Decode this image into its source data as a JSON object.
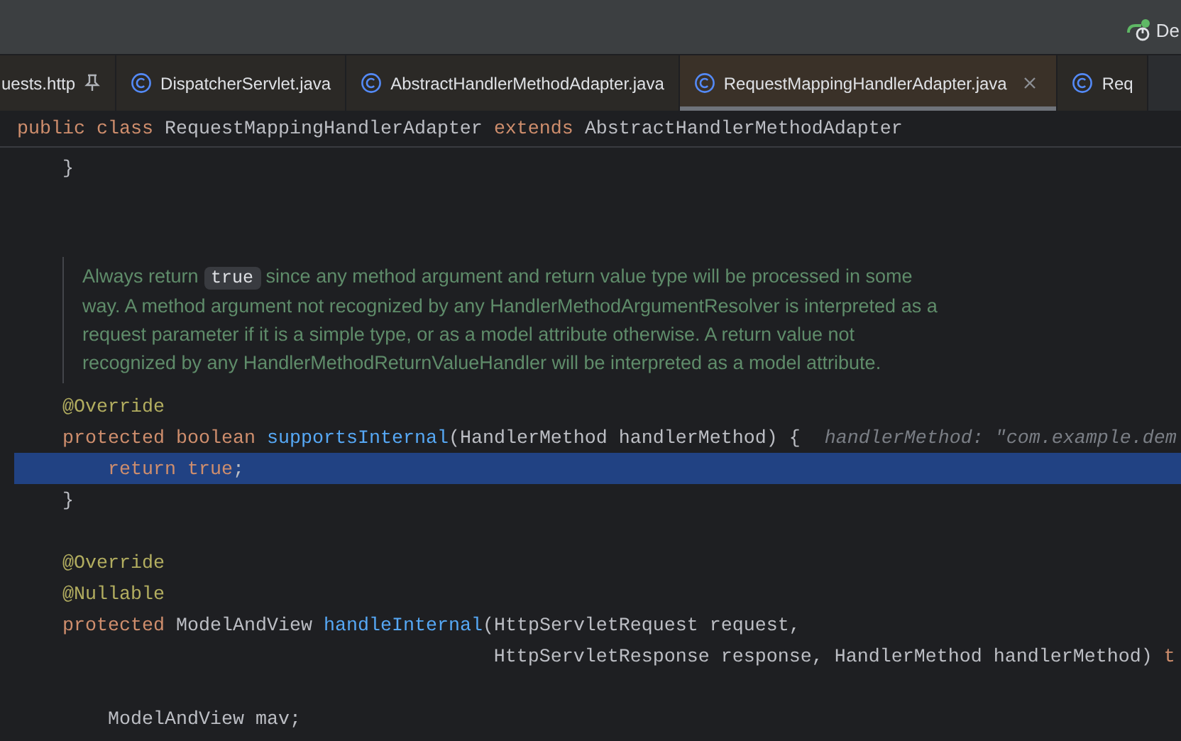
{
  "toolbar": {
    "run_config": "De"
  },
  "tabs": [
    {
      "label": "uests.http",
      "kind": "http",
      "pinned": true,
      "selected": false
    },
    {
      "label": "DispatcherServlet.java",
      "kind": "class",
      "pinned": false,
      "selected": false
    },
    {
      "label": "AbstractHandlerMethodAdapter.java",
      "kind": "class",
      "pinned": false,
      "selected": false
    },
    {
      "label": "RequestMappingHandlerAdapter.java",
      "kind": "class",
      "pinned": false,
      "selected": true
    },
    {
      "label": "Req",
      "kind": "class",
      "pinned": false,
      "selected": false
    }
  ],
  "sticky_header": [
    {
      "kind": "kw",
      "text": "public class "
    },
    {
      "kind": "plain",
      "text": "RequestMappingHandlerAdapter "
    },
    {
      "kind": "kw",
      "text": "extends "
    },
    {
      "kind": "plain",
      "text": "AbstractHandlerMethodAdapter"
    }
  ],
  "lines": [
    {
      "kind": "code",
      "highlighted": false,
      "tokens": [
        {
          "kind": "plain",
          "text": "    }"
        }
      ]
    },
    {
      "kind": "code",
      "highlighted": false
    },
    {
      "kind": "code",
      "highlighted": false
    },
    {
      "kind": "doc",
      "before": "Always return ",
      "code": "true",
      "after": " since any method argument and return value type will be processed in some way. A method argument not recognized by any HandlerMethodArgumentResolver is interpreted as a request parameter if it is a simple type, or as a model attribute otherwise. A return value not recognized by any HandlerMethodReturnValueHandler will be interpreted as a model attribute."
    },
    {
      "kind": "code",
      "highlighted": false,
      "tokens": [
        {
          "kind": "ann",
          "text": "    @Override"
        }
      ]
    },
    {
      "kind": "code",
      "highlighted": false,
      "tokens": [
        {
          "kind": "kw",
          "text": "    protected boolean "
        },
        {
          "kind": "fn",
          "text": "supportsInternal"
        },
        {
          "kind": "plain",
          "text": "(HandlerMethod handlerMethod) {"
        },
        {
          "kind": "hint",
          "text": "handlerMethod: \"com.example.dem"
        }
      ]
    },
    {
      "kind": "code",
      "highlighted": true,
      "tokens": [
        {
          "kind": "kw",
          "text": "        return true"
        },
        {
          "kind": "plain",
          "text": ";"
        }
      ]
    },
    {
      "kind": "code",
      "highlighted": false,
      "tokens": [
        {
          "kind": "plain",
          "text": "    }"
        }
      ]
    },
    {
      "kind": "code",
      "highlighted": false
    },
    {
      "kind": "code",
      "highlighted": false,
      "tokens": [
        {
          "kind": "ann",
          "text": "    @Override"
        }
      ]
    },
    {
      "kind": "code",
      "highlighted": false,
      "tokens": [
        {
          "kind": "ann",
          "text": "    @Nullable"
        }
      ]
    },
    {
      "kind": "code",
      "highlighted": false,
      "tokens": [
        {
          "kind": "kw",
          "text": "    protected "
        },
        {
          "kind": "plain",
          "text": "ModelAndView "
        },
        {
          "kind": "fn",
          "text": "handleInternal"
        },
        {
          "kind": "plain",
          "text": "(HttpServletRequest request,"
        }
      ]
    },
    {
      "kind": "code",
      "highlighted": false,
      "tokens": [
        {
          "kind": "plain",
          "text": "                                          HttpServletResponse response, HandlerMethod handlerMethod) "
        },
        {
          "kind": "kw",
          "text": "t"
        }
      ]
    },
    {
      "kind": "code",
      "highlighted": false
    },
    {
      "kind": "code",
      "highlighted": false,
      "tokens": [
        {
          "kind": "plain",
          "text": "        ModelAndView mav;"
        }
      ]
    }
  ]
}
